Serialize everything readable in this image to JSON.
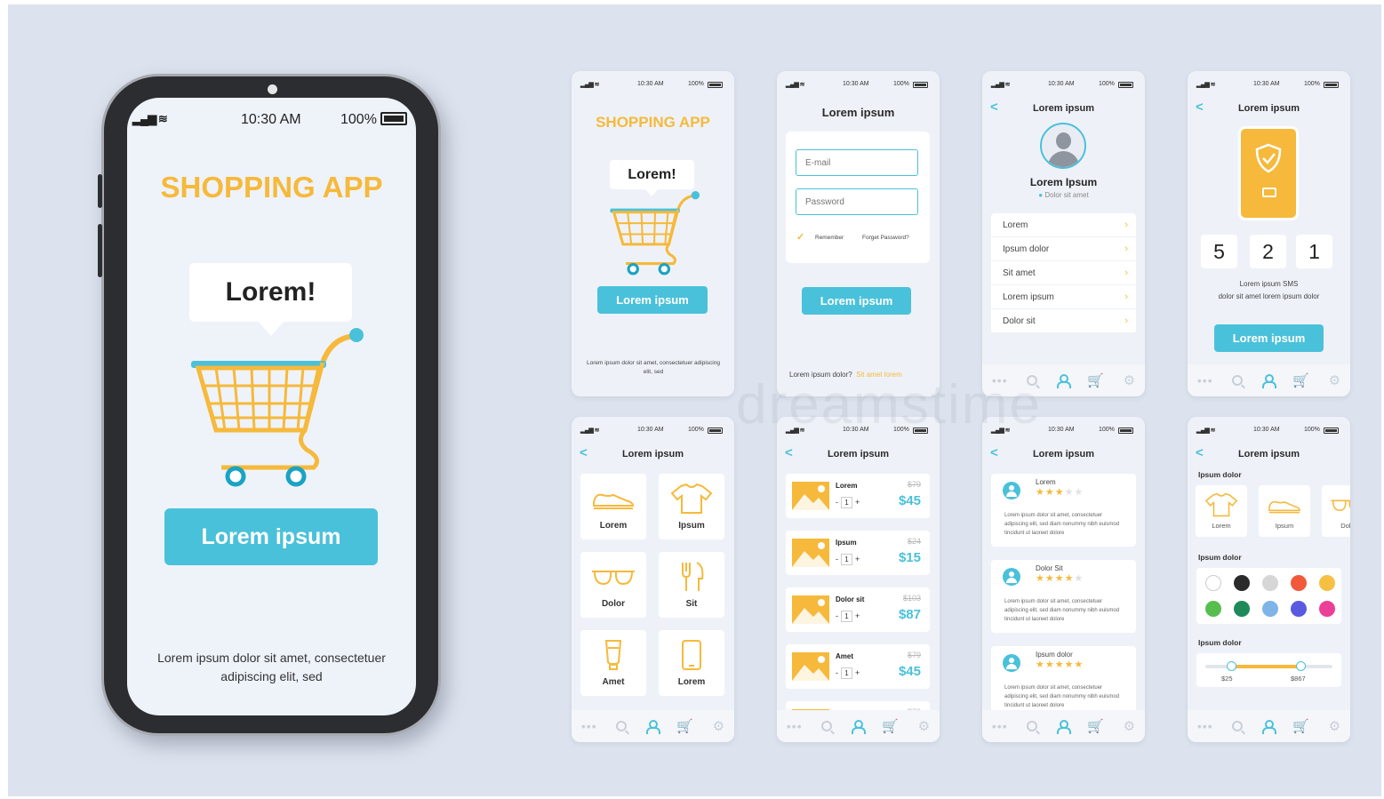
{
  "colors": {
    "accent": "#4ac1da",
    "brand": "#f6b93b",
    "background": "#dde3ee"
  },
  "status": {
    "signal": "▂▄▆ ≋",
    "time": "10:30 AM",
    "battery": "100%"
  },
  "hero": {
    "title": "SHOPPING APP",
    "bubble": "Lorem!",
    "button": "Lorem ipsum",
    "footer": "Lorem ipsum dolor sit amet, consectetuer adipiscing elit, sed"
  },
  "splash": {
    "title": "SHOPPING APP",
    "bubble": "Lorem!",
    "button": "Lorem ipsum",
    "footer": "Lorem ipsum dolor sit amet, consectetuer adipiscing elit, sed"
  },
  "login": {
    "header": "Lorem ipsum",
    "email_placeholder": "E-mail",
    "password_placeholder": "Password",
    "remember": "Remember",
    "forgot": "Forget Password?",
    "button": "Lorem ipsum",
    "footer_text": "Lorem ipsum dolor?",
    "footer_link": "Sit amet lorem"
  },
  "profile": {
    "header": "Lorem ipsum",
    "name": "Lorem Ipsum",
    "location": "Dolor sit amet",
    "items": [
      "Lorem",
      "Ipsum dolor",
      "Sit amet",
      "Lorem ipsum",
      "Dolor sit"
    ]
  },
  "verify": {
    "header": "Lorem ipsum",
    "digits": [
      "5",
      "2",
      "1"
    ],
    "text_line1": "Lorem ipsum SMS",
    "text_line2": "dolor sit amet lorem ipsum dolor",
    "button": "Lorem ipsum"
  },
  "categories": {
    "header": "Lorem ipsum",
    "tiles": [
      {
        "label": "Lorem",
        "icon": "shoe-icon"
      },
      {
        "label": "Ipsum",
        "icon": "tshirt-icon"
      },
      {
        "label": "Dolor",
        "icon": "glasses-icon"
      },
      {
        "label": "Sit",
        "icon": "cutlery-icon"
      },
      {
        "label": "Amet",
        "icon": "cosmetics-icon"
      },
      {
        "label": "Lorem",
        "icon": "smartphone-icon"
      }
    ]
  },
  "cart": {
    "header": "Lorem ipsum",
    "items": [
      {
        "name": "Lorem",
        "qty": "1",
        "old_price": "$79",
        "price": "$45"
      },
      {
        "name": "Ipsum",
        "qty": "1",
        "old_price": "$24",
        "price": "$15"
      },
      {
        "name": "Dolor sit",
        "qty": "1",
        "old_price": "$103",
        "price": "$87"
      },
      {
        "name": "Amet",
        "qty": "1",
        "old_price": "$79",
        "price": "$45"
      },
      {
        "name": "Lorem",
        "qty": "1",
        "old_price": "$79",
        "price": ""
      }
    ]
  },
  "reviews": {
    "header": "Lorem ipsum",
    "items": [
      {
        "name": "Lorem",
        "rating": 3,
        "body": "Lorem ipsum dolor sit amet, consectetuer adipiscing elit, sed diam nonummy nibh euismod tincidunt ut laoreet dolore"
      },
      {
        "name": "Dolor Sit",
        "rating": 4,
        "body": "Lorem ipsum dolor sit amet, consectetuer adipiscing elit, sed diam nonummy nibh euismod tincidunt ut laoreet dolore"
      },
      {
        "name": "Ipsum dolor",
        "rating": 5,
        "body": "Lorem ipsum dolor sit amet, consectetuer adipiscing elit, sed diam nonummy nibh euismod tincidunt ut laoreet dolore"
      }
    ]
  },
  "filters": {
    "header": "Lorem ipsum",
    "section1": "Ipsum dolor",
    "tiles": [
      {
        "label": "Lorem",
        "icon": "tshirt-icon"
      },
      {
        "label": "Ipsum",
        "icon": "shoe-icon"
      },
      {
        "label": "Dolo",
        "icon": "glasses-icon"
      }
    ],
    "section2": "Ipsum dolor",
    "swatches": [
      "#ffffff",
      "#2b2b2b",
      "#d6d6d6",
      "#f05a3a",
      "#f6c143",
      "#56be4e",
      "#1e8a5a",
      "#7fb4e8",
      "#5a5ae0",
      "#ec3f98"
    ],
    "section3": "Ipsum dolor",
    "range_min": "$25",
    "range_max": "$867",
    "range_low": 0.2,
    "range_high": 0.75
  },
  "watermark": "dreamstime"
}
